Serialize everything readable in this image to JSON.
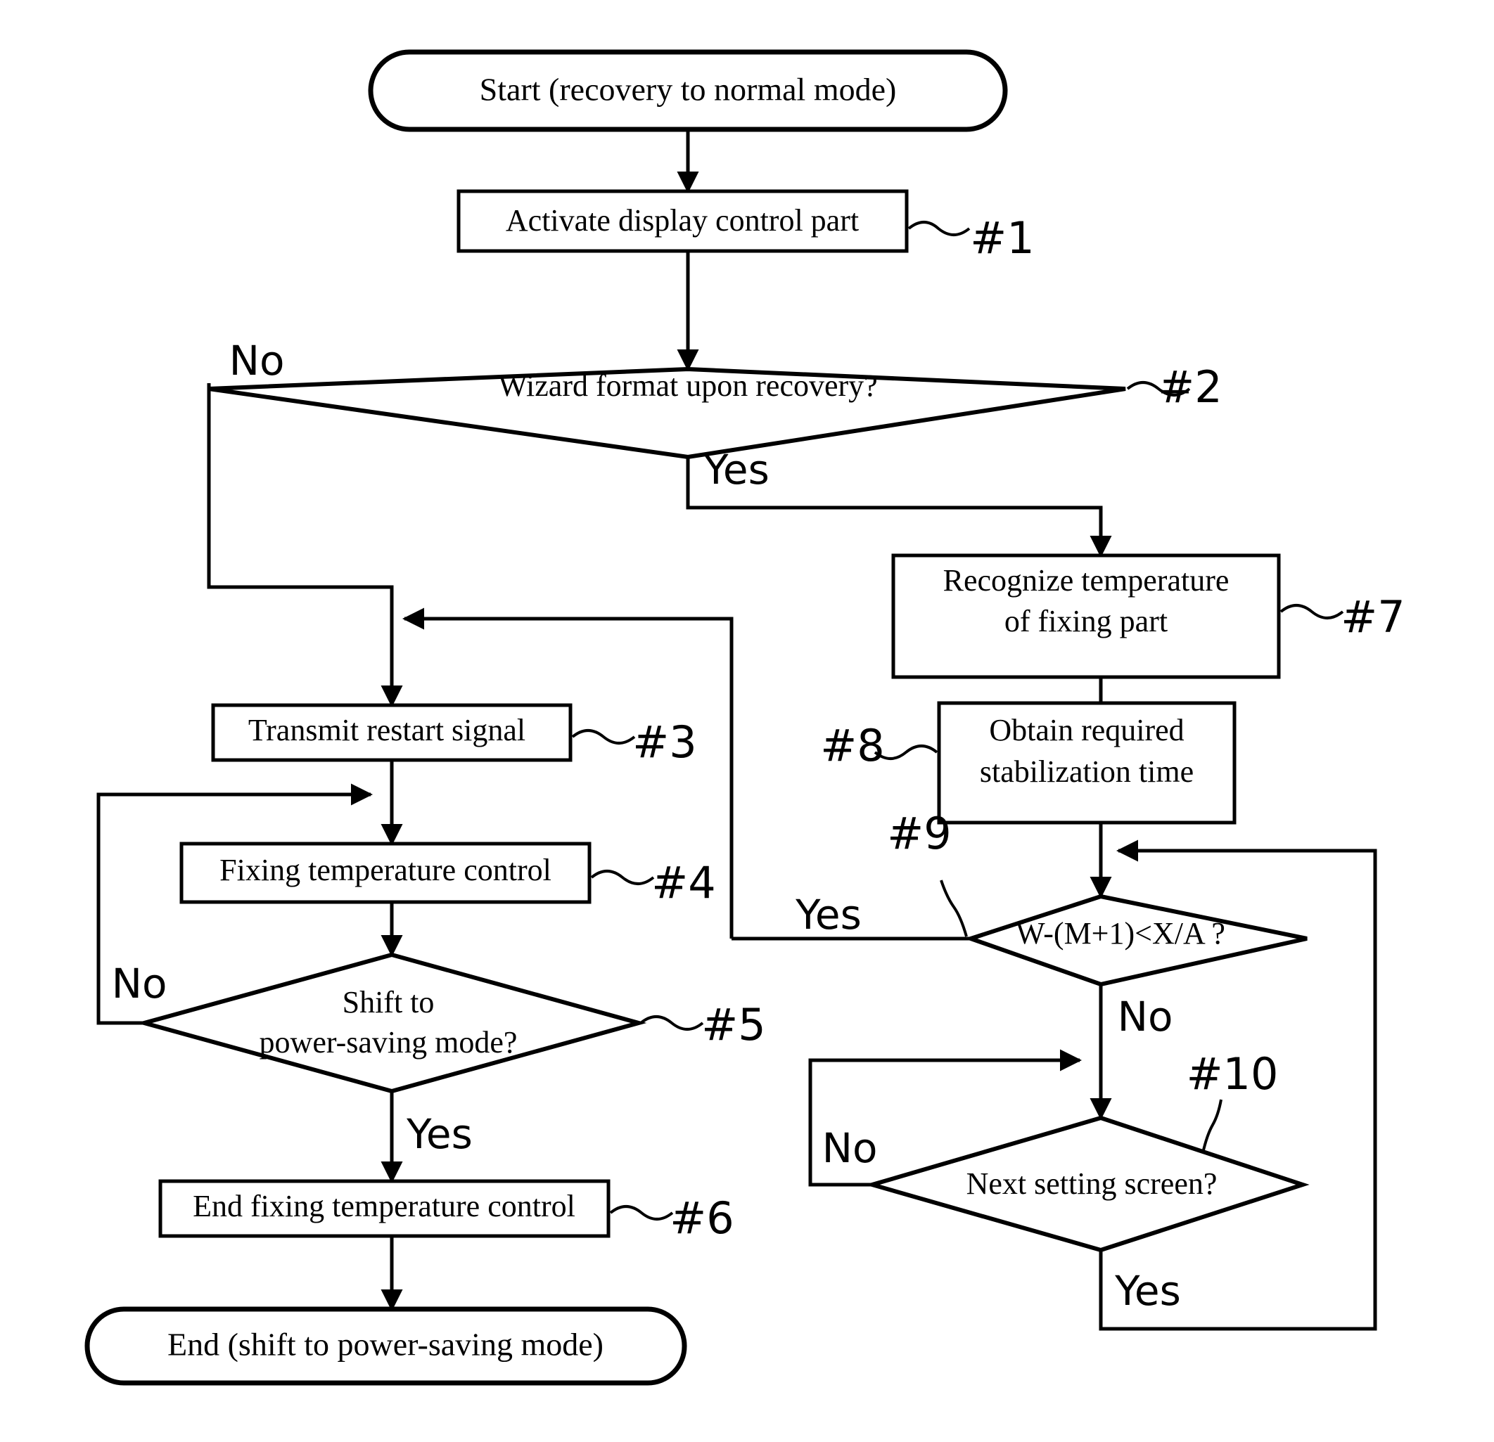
{
  "diagram": {
    "title": "Recovery to normal mode flowchart",
    "background_color": "#ffffff",
    "line_color": "#000000"
  },
  "chart_data": {
    "type": "diagram",
    "kind": "flowchart",
    "nodes": [
      {
        "id": "start",
        "shape": "terminator",
        "text": "Start (recovery to normal mode)",
        "ref": ""
      },
      {
        "id": "n1",
        "shape": "process",
        "text": "Activate display control part",
        "ref": "#1"
      },
      {
        "id": "n2",
        "shape": "decision",
        "text": "Wizard format upon recovery?",
        "ref": "#2"
      },
      {
        "id": "n3",
        "shape": "process",
        "text": "Transmit restart signal",
        "ref": "#3"
      },
      {
        "id": "n4",
        "shape": "process",
        "text": "Fixing temperature control",
        "ref": "#4"
      },
      {
        "id": "n5",
        "shape": "decision",
        "text_line1": "Shift to",
        "text_line2": "power-saving mode?",
        "ref": "#5"
      },
      {
        "id": "n6",
        "shape": "process",
        "text": "End fixing temperature control",
        "ref": "#6"
      },
      {
        "id": "end",
        "shape": "terminator",
        "text": "End (shift to power-saving mode)",
        "ref": ""
      },
      {
        "id": "n7",
        "shape": "process",
        "text_line1": "Recognize temperature",
        "text_line2": "of fixing part",
        "ref": "#7"
      },
      {
        "id": "n8",
        "shape": "process",
        "text_line1": "Obtain required",
        "text_line2": "stabilization time",
        "ref": "#8"
      },
      {
        "id": "n9",
        "shape": "decision",
        "text": "W-(M+1)<X/A ?",
        "ref": "#9"
      },
      {
        "id": "n10",
        "shape": "decision",
        "text": "Next setting screen?",
        "ref": "#10"
      }
    ],
    "edges": [
      {
        "from": "start",
        "to": "n1",
        "label": ""
      },
      {
        "from": "n1",
        "to": "n2",
        "label": ""
      },
      {
        "from": "n2",
        "to": "n3",
        "label": "No"
      },
      {
        "from": "n2",
        "to": "n7",
        "label": "Yes"
      },
      {
        "from": "n3",
        "to": "n4",
        "label": ""
      },
      {
        "from": "n4",
        "to": "n5",
        "label": ""
      },
      {
        "from": "n5",
        "to": "n4",
        "label": "No"
      },
      {
        "from": "n5",
        "to": "n6",
        "label": "Yes"
      },
      {
        "from": "n6",
        "to": "end",
        "label": ""
      },
      {
        "from": "n7",
        "to": "n8",
        "label": ""
      },
      {
        "from": "n8",
        "to": "n9",
        "label": ""
      },
      {
        "from": "n9",
        "to": "n3",
        "label": "Yes"
      },
      {
        "from": "n9",
        "to": "n10",
        "label": "No"
      },
      {
        "from": "n10",
        "to": "n10_loop",
        "label": "No"
      },
      {
        "from": "n10",
        "to": "n9",
        "label": "Yes"
      }
    ]
  },
  "labels": {
    "start": "Start (recovery to normal mode)",
    "n1": "Activate display control part",
    "n2": "Wizard format upon recovery?",
    "n3": "Transmit restart signal",
    "n4": "Fixing temperature control",
    "n5_line1": "Shift to",
    "n5_line2": "power-saving mode?",
    "n6": "End fixing temperature control",
    "end": "End (shift to power-saving mode)",
    "n7_line1": "Recognize temperature",
    "n7_line2": "of fixing part",
    "n8_line1": "Obtain required",
    "n8_line2": "stabilization time",
    "n9": "W-(M+1)<X/A ?",
    "n10": "Next setting screen?"
  },
  "refs": {
    "r1": "#1",
    "r2": "#2",
    "r3": "#3",
    "r4": "#4",
    "r5": "#5",
    "r6": "#6",
    "r7": "#7",
    "r8": "#8",
    "r9": "#9",
    "r10": "#10"
  },
  "branches": {
    "n2_no": "No",
    "n2_yes": "Yes",
    "n5_no": "No",
    "n5_yes": "Yes",
    "n9_yes": "Yes",
    "n9_no": "No",
    "n10_no": "No",
    "n10_yes": "Yes"
  }
}
